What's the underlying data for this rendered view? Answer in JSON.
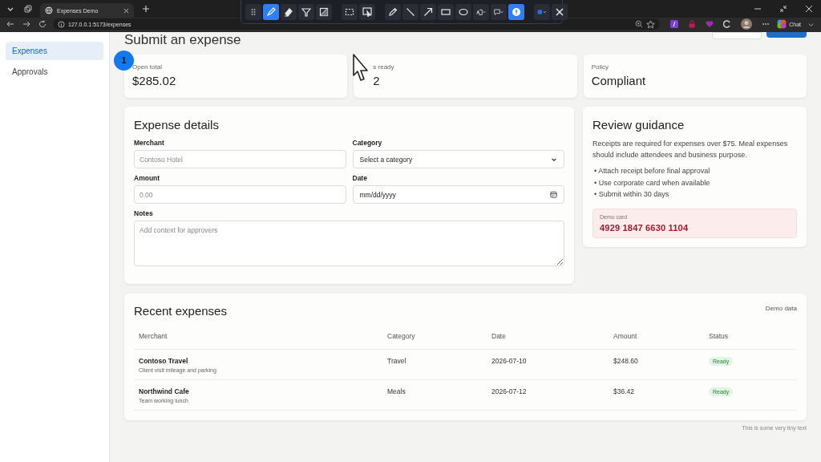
{
  "browser": {
    "tab_title": "Expenses Demo",
    "url": "127.0.0.1:5173/expenses",
    "chat_label": "Chat"
  },
  "annotation_toolbar": {
    "tools": [
      {
        "kind": "grip",
        "selected": false
      },
      {
        "kind": "highlighter",
        "selected": true
      },
      {
        "kind": "eraser",
        "selected": false
      },
      {
        "kind": "funnel",
        "selected": false
      },
      {
        "kind": "crop",
        "selected": false
      },
      {
        "kind": "separator"
      },
      {
        "kind": "region",
        "selected": false
      },
      {
        "kind": "window",
        "selected": false
      },
      {
        "kind": "separator"
      },
      {
        "kind": "pencil",
        "selected": false
      },
      {
        "kind": "line",
        "selected": false
      },
      {
        "kind": "arrow",
        "selected": false
      },
      {
        "kind": "rectangle",
        "selected": false
      },
      {
        "kind": "ellipse",
        "selected": false
      },
      {
        "kind": "textbox",
        "selected": false
      },
      {
        "kind": "callout",
        "selected": false
      },
      {
        "kind": "step",
        "selected": true
      },
      {
        "kind": "separator"
      },
      {
        "kind": "color",
        "selected": false
      },
      {
        "kind": "close",
        "selected": false
      }
    ]
  },
  "sidebar": {
    "items": [
      {
        "label": "Expenses",
        "selected": true
      },
      {
        "label": "Approvals",
        "selected": false
      }
    ]
  },
  "page_title": "Submit an expense",
  "step_marker": "1",
  "stats": [
    {
      "label": "Open total",
      "value": "$285.02"
    },
    {
      "label": "s ready",
      "value": "2"
    },
    {
      "label": "Policy",
      "value": "Compliant"
    }
  ],
  "expense_details": {
    "title": "Expense details",
    "fields": [
      {
        "kind": "text",
        "label": "Merchant",
        "placeholder": "Contoso Hotel"
      },
      {
        "kind": "select",
        "label": "Category",
        "value": "Select a category"
      },
      {
        "kind": "text",
        "label": "Amount",
        "placeholder": "0.00"
      },
      {
        "kind": "date",
        "label": "Date",
        "value": "mm/dd/yyyy"
      },
      {
        "kind": "textarea",
        "label": "Notes",
        "placeholder": "Add context for approvers"
      }
    ]
  },
  "review_guidance": {
    "title": "Review guidance",
    "text": "Receipts are required for expenses over $75. Meal expenses should include attendees and business purpose.",
    "bullets": [
      "• Attach receipt before final approval",
      "• Use corporate card when available",
      "• Submit within 30 days"
    ],
    "demo_card": {
      "label": "Demo card",
      "number": "4929 1847 6630 1104"
    }
  },
  "recent_expenses": {
    "title": "Recent expenses",
    "note": "Demo data",
    "columns": [
      "Merchant",
      "Category",
      "Date",
      "Amount",
      "Status"
    ],
    "rows": [
      {
        "merchant": "Contoso Travel",
        "description": "Client visit mileage and parking",
        "category": "Travel",
        "date": "2026-07-10",
        "amount": "$248.60",
        "status": "Ready"
      },
      {
        "merchant": "Northwind Cafe",
        "description": "Team working lunch",
        "category": "Meals",
        "date": "2026-07-12",
        "amount": "$36.42",
        "status": "Ready"
      }
    ]
  },
  "footer_text": "This is some very tiny text"
}
